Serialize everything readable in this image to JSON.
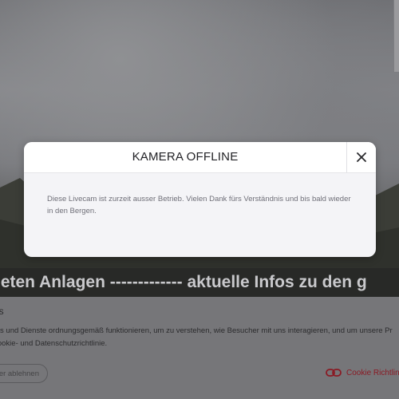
{
  "modal": {
    "title": "KAMERA OFFLINE",
    "close_icon": "close-icon",
    "body": "Diese Livecam ist zurzeit ausser Betrieb. Vielen Dank fürs Verständnis und bis bald wieder in den Bergen."
  },
  "ticker": {
    "text": "neten Anlagen -------------   aktuelle Infos zu den g"
  },
  "cookie": {
    "title": "es",
    "text_lines": [
      "ites und Dienste ordnungsgemäß funktionieren, um zu verstehen, wie Besucher mit uns interagieren, und um unsere Pr",
      "Cookie- und Datenschutzrichtlinie."
    ],
    "decline_label": "der ablehnen",
    "policy_label": "Cookie Richtlin",
    "policy_icon": "link-icon",
    "accent_color": "#8a1a24"
  }
}
